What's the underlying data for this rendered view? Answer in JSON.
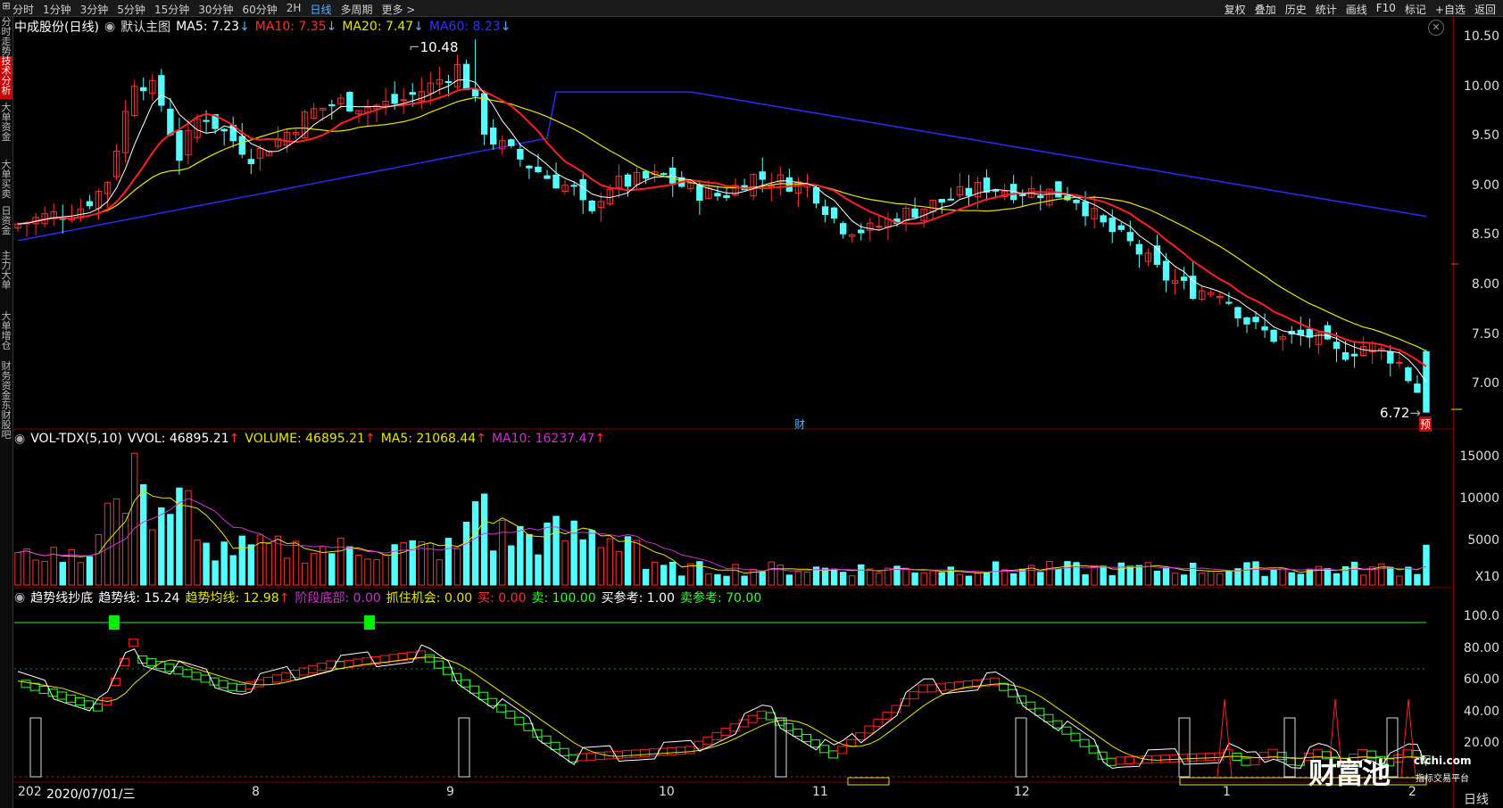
{
  "topbar": {
    "tabs": [
      "分时",
      "1分钟",
      "3分钟",
      "5分钟",
      "15分钟",
      "30分钟",
      "60分钟",
      "2H",
      "日线",
      "多周期",
      "更多 >"
    ],
    "active_tab": "日线",
    "right_buttons": [
      "复权",
      "叠加",
      "历史",
      "统计",
      "画线",
      "F10",
      "标记",
      "+自选",
      "返回"
    ]
  },
  "leftnav": [
    "分时走势",
    "技术分析",
    "大单资金",
    "大单买卖",
    "日资金",
    "主力大单",
    "大单增仓",
    "财务资金",
    "东财股吧"
  ],
  "main": {
    "stock_title": "中成股份(日线)",
    "template": "默认主图",
    "ma5": "MA5: 7.23",
    "ma10": "MA10: 7.35",
    "ma20": "MA20: 7.47",
    "ma60": "MA60: 8.23",
    "high_label": "10.48",
    "low_label": "6.72",
    "fin_mark": "财",
    "pred_mark": "预",
    "y_ticks": [
      "10.50",
      "10.00",
      "9.50",
      "9.00",
      "8.50",
      "8.00",
      "7.50",
      "7.00"
    ]
  },
  "vol": {
    "title": "VOL-TDX(5,10)",
    "vvol": "VVOL: 46895.21",
    "volume": "VOLUME: 46895.21",
    "ma5": "MA5: 21068.44",
    "ma10": "MA10: 16237.47",
    "y_ticks": [
      "15000",
      "10000",
      "5000"
    ],
    "unit": "X10"
  },
  "ind": {
    "title": "趋势线抄底",
    "trend": "趋势线: 15.24",
    "trend_avg": "趋势均线: 12.98",
    "stage_bottom": "阶段底部: 0.00",
    "catch": "抓住机会: 0.00",
    "buy": "买: 0.00",
    "sell": "卖: 100.00",
    "buy_ref": "买参考: 1.00",
    "sell_ref": "卖参考: 70.00",
    "y_ticks": [
      "100.0",
      "80.00",
      "60.00",
      "40.00",
      "20.00"
    ]
  },
  "xaxis": {
    "date_label": "2020/07/01/三",
    "date_prefix": "202",
    "months": [
      "8",
      "9",
      "10",
      "11",
      "12",
      "1",
      "2"
    ],
    "period": "日线"
  },
  "watermark": {
    "brand": "财富池",
    "url": "cfchi.com",
    "tagline": "指标交易平台"
  },
  "colors": {
    "up": "#ff3030",
    "down": "#54ffff",
    "ma5": "#ffffff",
    "ma10": "#ff2020",
    "ma20": "#e6e600",
    "ma60": "#2a2aff",
    "vol_ma10": "#cc33cc"
  },
  "chart_data": {
    "type": "candlestick",
    "y_range": [
      6.6,
      10.6
    ],
    "price_high": 10.48,
    "price_low": 6.72,
    "ma_last": {
      "MA5": 7.23,
      "MA10": 7.35,
      "MA20": 7.47,
      "MA60": 8.23
    },
    "volume_last": 46895.21,
    "volume_ma_last": {
      "MA5": 21068.44,
      "MA10": 16237.47
    }
  }
}
